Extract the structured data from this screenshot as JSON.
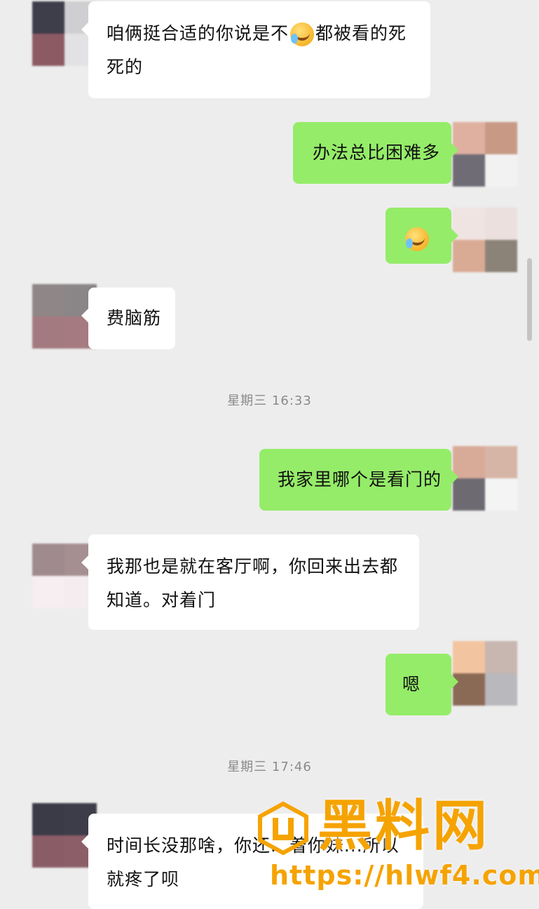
{
  "messages": [
    {
      "text_before": "咱俩挺合适的你说是不",
      "emoji": "crying-laughing-emoji",
      "text_after": "都被看的死死的"
    },
    {
      "text": "办法总比困难多"
    },
    {
      "emoji": "crying-laughing-emoji"
    },
    {
      "text": "费脑筋"
    },
    {
      "text": "我家里哪个是看门的"
    },
    {
      "text": "我那也是就在客厅啊，你回来出去都知道。对着门"
    },
    {
      "text": "嗯"
    },
    {
      "text": "时间长没那啥，你还...着你妹...所以就疼了呗"
    }
  ],
  "timestamps": [
    "星期三 16:33",
    "星期三 17:46"
  ],
  "watermark": {
    "title": "黑料网",
    "url": "https://hlwf4.com"
  },
  "colors": {
    "background": "#ededed",
    "incoming": "#ffffff",
    "outgoing": "#95ec69",
    "watermark": "#f5a300"
  }
}
